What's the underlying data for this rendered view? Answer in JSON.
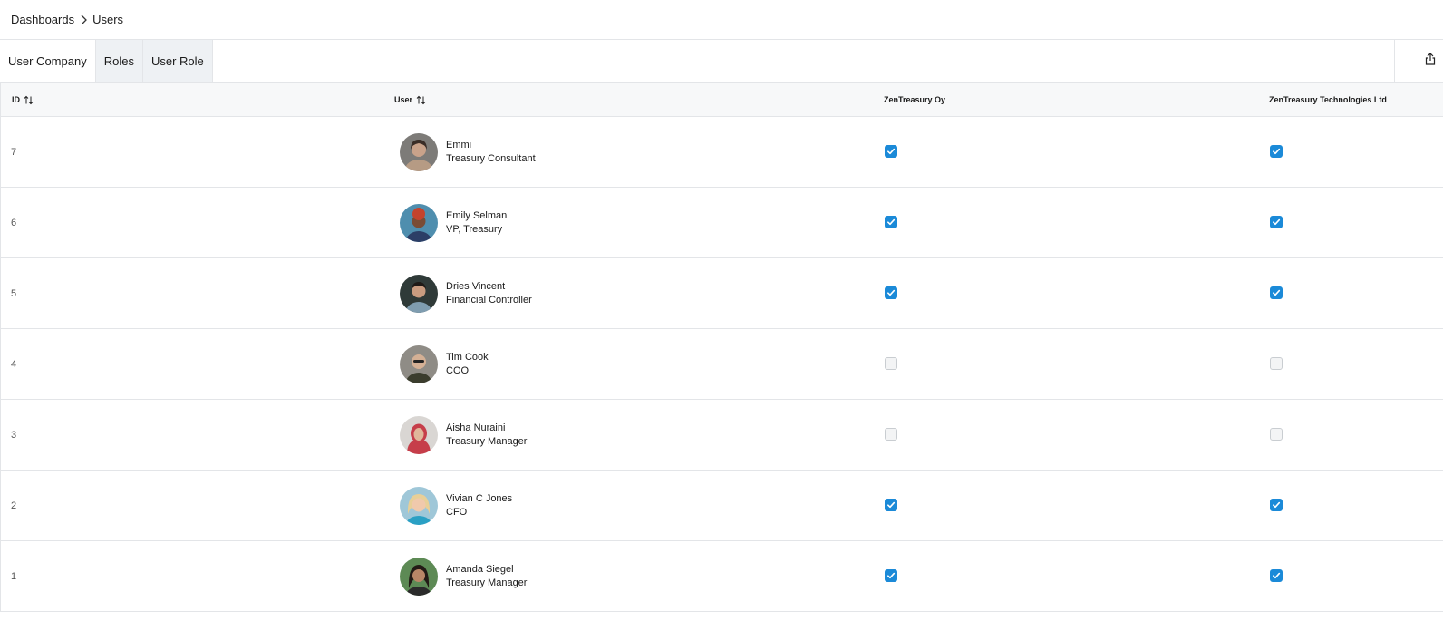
{
  "breadcrumb": {
    "parent": "Dashboards",
    "current": "Users"
  },
  "tabs": [
    {
      "label": "User Company"
    },
    {
      "label": "Roles"
    },
    {
      "label": "User Role"
    }
  ],
  "table": {
    "columns": {
      "id": "ID",
      "user": "User",
      "company_a": "ZenTreasury Oy",
      "company_b": "ZenTreasury Technologies Ltd"
    },
    "rows": [
      {
        "id": "7",
        "name": "Emmi",
        "title": "Treasury Consultant",
        "company_a": true,
        "company_b": true
      },
      {
        "id": "6",
        "name": "Emily Selman",
        "title": "VP, Treasury",
        "company_a": true,
        "company_b": true
      },
      {
        "id": "5",
        "name": "Dries Vincent",
        "title": "Financial Controller",
        "company_a": true,
        "company_b": true
      },
      {
        "id": "4",
        "name": "Tim Cook",
        "title": "COO",
        "company_a": false,
        "company_b": false
      },
      {
        "id": "3",
        "name": "Aisha Nuraini",
        "title": "Treasury Manager",
        "company_a": false,
        "company_b": false
      },
      {
        "id": "2",
        "name": "Vivian C Jones",
        "title": "CFO",
        "company_a": true,
        "company_b": true
      },
      {
        "id": "1",
        "name": "Amanda Siegel",
        "title": "Treasury Manager",
        "company_a": true,
        "company_b": true
      }
    ]
  },
  "icons": {
    "breadcrumb_separator": "chevron-right-icon",
    "share": "share-icon",
    "sort": "sort-icon",
    "checkbox_checked": "checkmark-icon"
  },
  "colors": {
    "checkbox_checked": "#1b8ad8",
    "checkbox_unchecked": "#f3f4f5",
    "header_background": "#f7f8f9",
    "tab_shaded": "#eef1f4",
    "border": "#e3e5e8"
  }
}
